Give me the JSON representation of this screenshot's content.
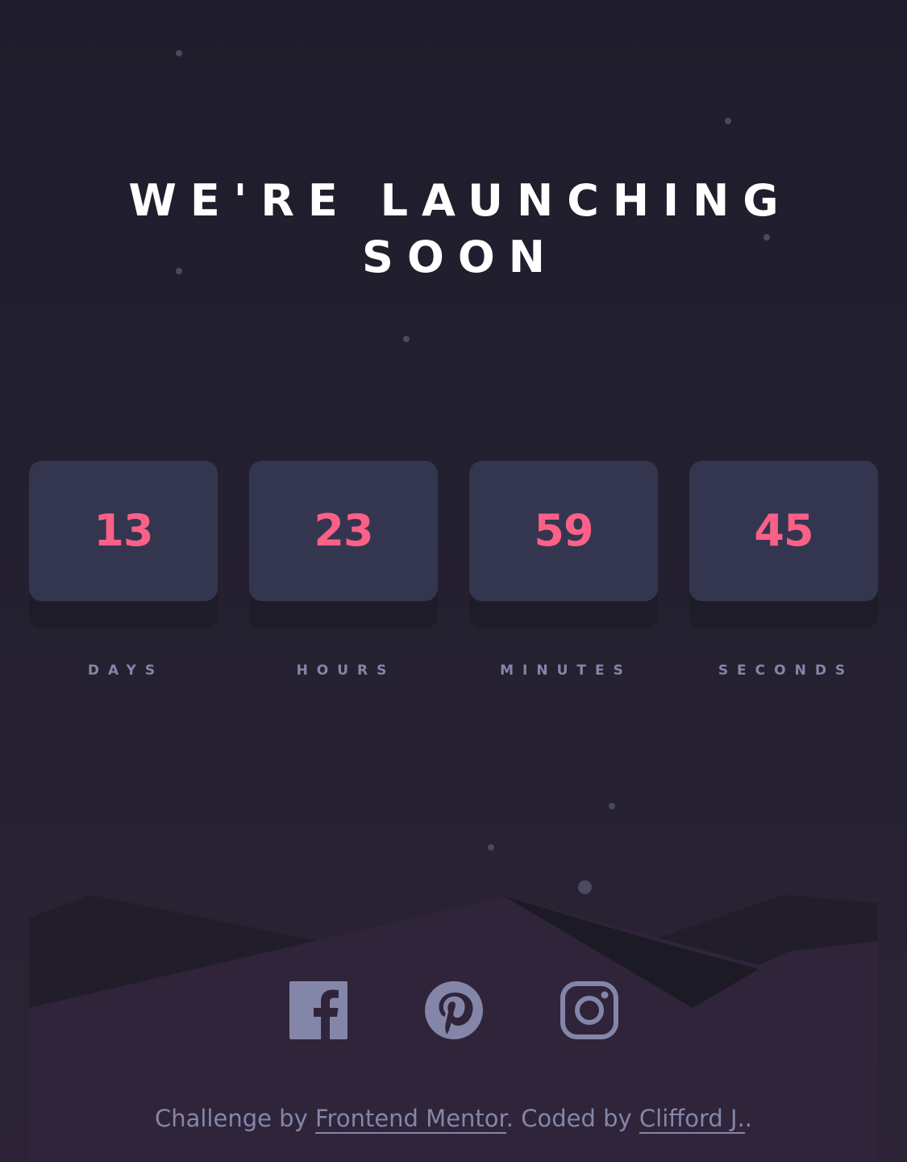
{
  "page": {
    "title_line1": "WE'RE LAUNCHING",
    "title_line2": "SOON"
  },
  "countdown": [
    {
      "value": "13",
      "label": "DAYS"
    },
    {
      "value": "23",
      "label": "HOURS"
    },
    {
      "value": "59",
      "label": "MINUTES"
    },
    {
      "value": "45",
      "label": "SECONDS"
    }
  ],
  "socials": [
    {
      "name": "facebook-icon"
    },
    {
      "name": "pinterest-icon"
    },
    {
      "name": "instagram-icon"
    }
  ],
  "footer": {
    "prefix": "Challenge by ",
    "link1": "Frontend Mentor",
    "middle": ". Coded by ",
    "link2": "Clifford J.",
    "suffix": "."
  },
  "colors": {
    "accent": "#fb6087",
    "card": "#343650",
    "card_shadow": "#1e1c28",
    "label": "#8486a9",
    "background": "#1f1d2b",
    "hills": "#2f2439"
  }
}
